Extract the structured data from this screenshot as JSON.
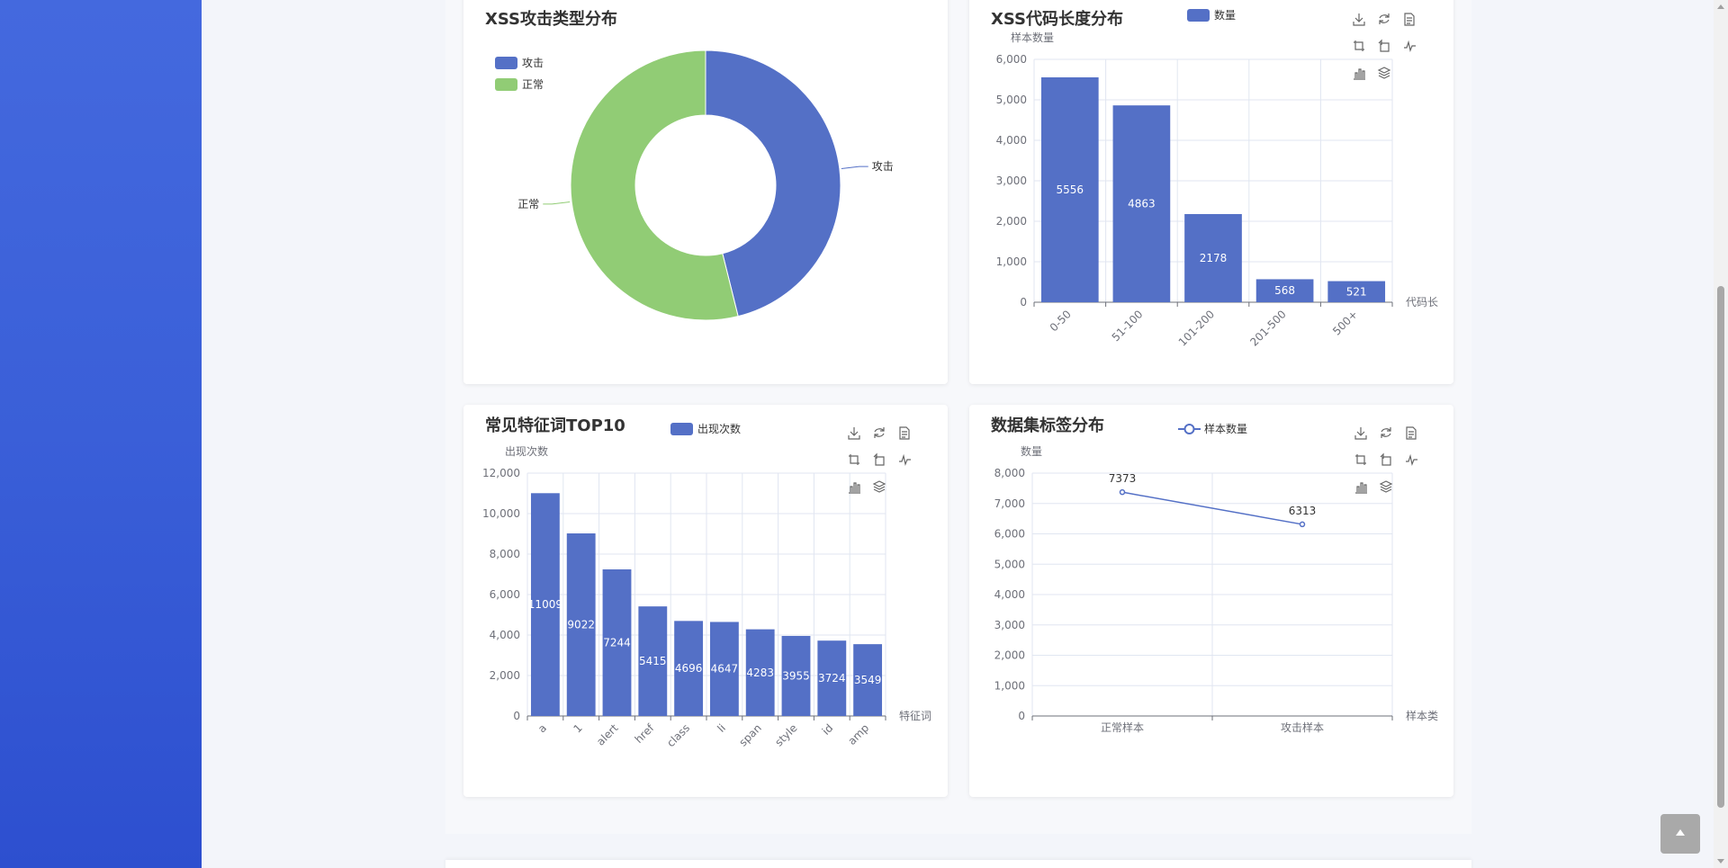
{
  "colors": {
    "attack": "#5470c6",
    "normal": "#91cc75",
    "axis": "#6e7079",
    "grid": "#e0e6f1"
  },
  "toolbox_icons": [
    "download-icon",
    "refresh-icon",
    "data-view-icon",
    "zoom-icon",
    "zoom-reset-icon",
    "line-icon",
    "bar-icon",
    "stack-icon"
  ],
  "chart_data": [
    {
      "type": "pie",
      "title": "XSS攻击类型分布",
      "legend": [
        "攻击",
        "正常"
      ],
      "slices": [
        {
          "name": "攻击",
          "value": 6313
        },
        {
          "name": "正常",
          "value": 7373
        }
      ]
    },
    {
      "type": "bar",
      "title": "XSS代码长度分布",
      "legend": [
        "数量"
      ],
      "series": [
        {
          "name": "数量",
          "values": [
            5556,
            4863,
            2178,
            568,
            521
          ]
        }
      ],
      "categories": [
        "0-50",
        "51-100",
        "101-200",
        "201-500",
        "500+"
      ],
      "ylabel": "样本数量",
      "xlabel": "代码长",
      "ylim": [
        0,
        6000
      ],
      "yticks": [
        "0",
        "1,000",
        "2,000",
        "3,000",
        "4,000",
        "5,000",
        "6,000"
      ]
    },
    {
      "type": "bar",
      "title": "常见特征词TOP10",
      "legend": [
        "出现次数"
      ],
      "series": [
        {
          "name": "出现次数",
          "values": [
            11009,
            9022,
            7244,
            5415,
            4696,
            4647,
            4283,
            3955,
            3724,
            3549
          ]
        }
      ],
      "categories": [
        "a",
        "1",
        "alert",
        "href",
        "class",
        "li",
        "span",
        "style",
        "id",
        "amp"
      ],
      "ylabel": "出现次数",
      "xlabel": "特征词",
      "ylim": [
        0,
        12000
      ],
      "yticks": [
        "0",
        "2,000",
        "4,000",
        "6,000",
        "8,000",
        "10,000",
        "12,000"
      ]
    },
    {
      "type": "line",
      "title": "数据集标签分布",
      "legend": [
        "样本数量"
      ],
      "series": [
        {
          "name": "样本数量",
          "values": [
            7373,
            6313
          ]
        }
      ],
      "categories": [
        "正常样本",
        "攻击样本"
      ],
      "ylabel": "数量",
      "xlabel": "样本类",
      "ylim": [
        0,
        8000
      ],
      "yticks": [
        "0",
        "1,000",
        "2,000",
        "3,000",
        "4,000",
        "5,000",
        "6,000",
        "7,000",
        "8,000"
      ]
    }
  ]
}
